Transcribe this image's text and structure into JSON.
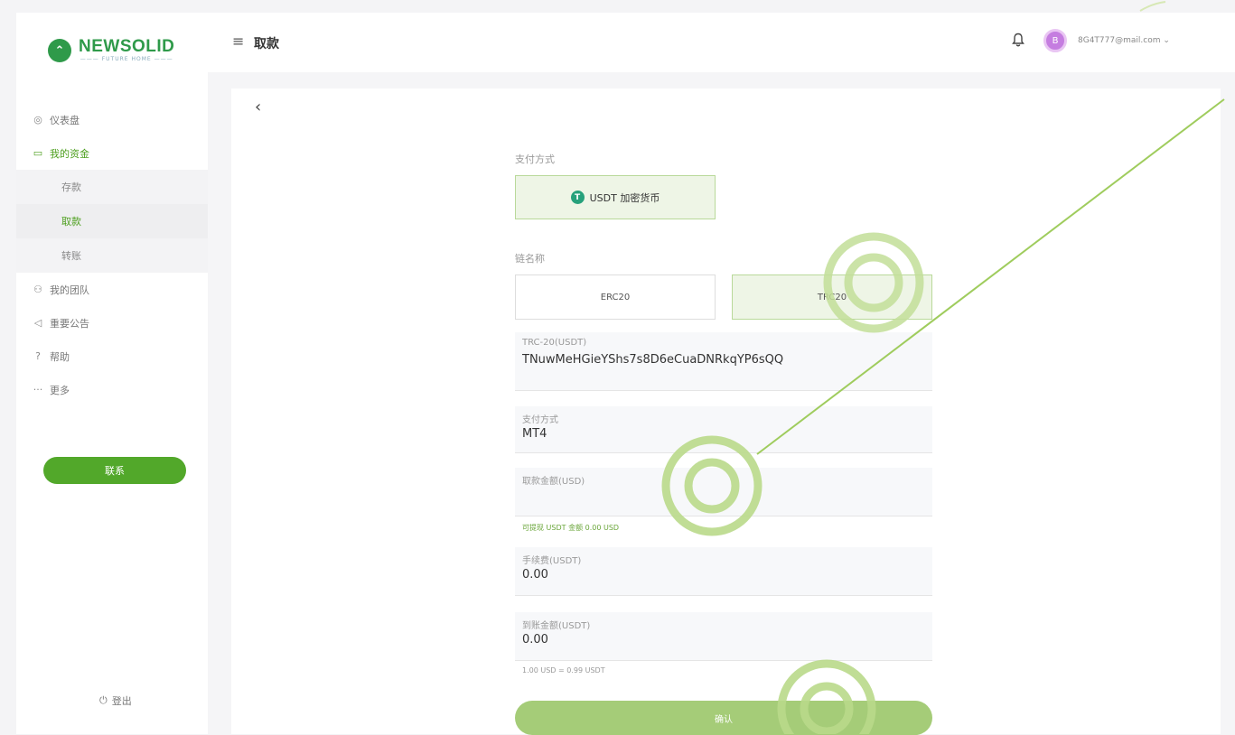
{
  "brand": {
    "name": "NEWSOLID",
    "tagline": "——— FUTURE  HOME ———"
  },
  "sidebar": {
    "items": [
      {
        "icon": "dashboard-icon",
        "glyph": "◎",
        "label": "仪表盘"
      },
      {
        "icon": "wallet-icon",
        "glyph": "▭",
        "label": "我的资金",
        "active": true
      },
      {
        "sub": "存款"
      },
      {
        "sub": "取款",
        "current": true
      },
      {
        "sub": "转账"
      },
      {
        "icon": "team-icon",
        "glyph": "⚇",
        "label": "我的团队"
      },
      {
        "icon": "announcement-icon",
        "glyph": "◁",
        "label": "重要公告"
      },
      {
        "icon": "help-icon",
        "glyph": "?",
        "label": "帮助"
      },
      {
        "icon": "more-icon",
        "glyph": "···",
        "label": "更多"
      }
    ],
    "contact_label": "联系",
    "logout_label": "登出"
  },
  "header": {
    "title": "取款",
    "avatar_letter": "B",
    "user_email": "8G4T777@mail.com"
  },
  "form": {
    "payment_method_label": "支付方式",
    "payment_option": "USDT 加密货币",
    "chain_label": "链名称",
    "chains": [
      "ERC20",
      "TRC20"
    ],
    "selected_chain": "TRC20",
    "address": {
      "label": "TRC-20(USDT)",
      "value": "TNuwMeHGieYShs7s8D6eCuaDNRkqYP6sQQ"
    },
    "method": {
      "label": "支付方式",
      "value": "MT4"
    },
    "amount": {
      "label": "取款金额(USD)",
      "value": ""
    },
    "available_hint": "可提现 USDT 金额 0.00 USD",
    "fee": {
      "label": "手续费(USDT)",
      "value": "0.00"
    },
    "arrival": {
      "label": "到账金额(USDT)",
      "value": "0.00"
    },
    "rate_hint": "1.00 USD = 0.99 USDT",
    "confirm_label": "确认"
  },
  "colors": {
    "accent": "#52a82a",
    "selected_bg": "#eef5e6",
    "confirm_bg": "#a5cc78",
    "hint_green": "#6aa63a",
    "ring": "#b6d98a"
  }
}
